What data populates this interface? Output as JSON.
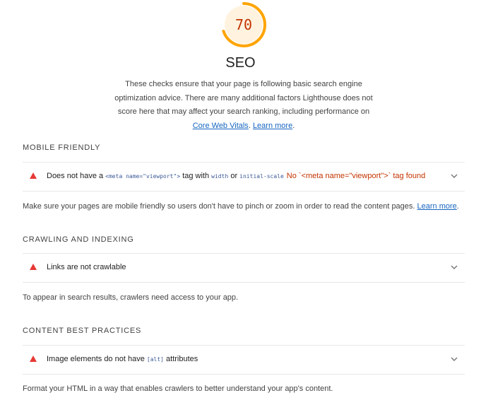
{
  "category": {
    "score": "70",
    "score_color": "#c33300",
    "gauge_color": "#ffa400",
    "gauge_bg_color": "#fff3e0",
    "score_fraction": 0.7,
    "title": "SEO",
    "description_text": "These checks ensure that your page is following basic search engine optimization advice. There are many additional factors Lighthouse does not score here that may affect your search ranking, including performance on ",
    "link_cwv": "Core Web Vitals",
    "separator": ". ",
    "link_learn": "Learn more",
    "description_end": "."
  },
  "groups": [
    {
      "title": "MOBILE FRIENDLY",
      "audit": {
        "icon": "fail-triangle-icon",
        "title_part1": "Does not have a ",
        "code1": "<meta name=\"viewport\">",
        "title_part2": " tag with ",
        "code2": "width",
        "title_part3": " or ",
        "code3": "initial-scale",
        "display_value": "No `<meta name=\"viewport\">` tag found"
      },
      "description": "Make sure your pages are mobile friendly so users don't have to pinch or zoom in order to read the content pages. ",
      "link": "Learn more",
      "description_end": "."
    },
    {
      "title": "CRAWLING AND INDEXING",
      "audit": {
        "icon": "fail-triangle-icon",
        "title": "Links are not crawlable"
      },
      "description": "To appear in search results, crawlers need access to your app."
    },
    {
      "title": "CONTENT BEST PRACTICES",
      "audit": {
        "icon": "fail-triangle-icon",
        "title_part1": "Image elements do not have ",
        "code1": "[alt]",
        "title_part2": " attributes"
      },
      "description": "Format your HTML in a way that enables crawlers to better understand your app's content."
    }
  ]
}
